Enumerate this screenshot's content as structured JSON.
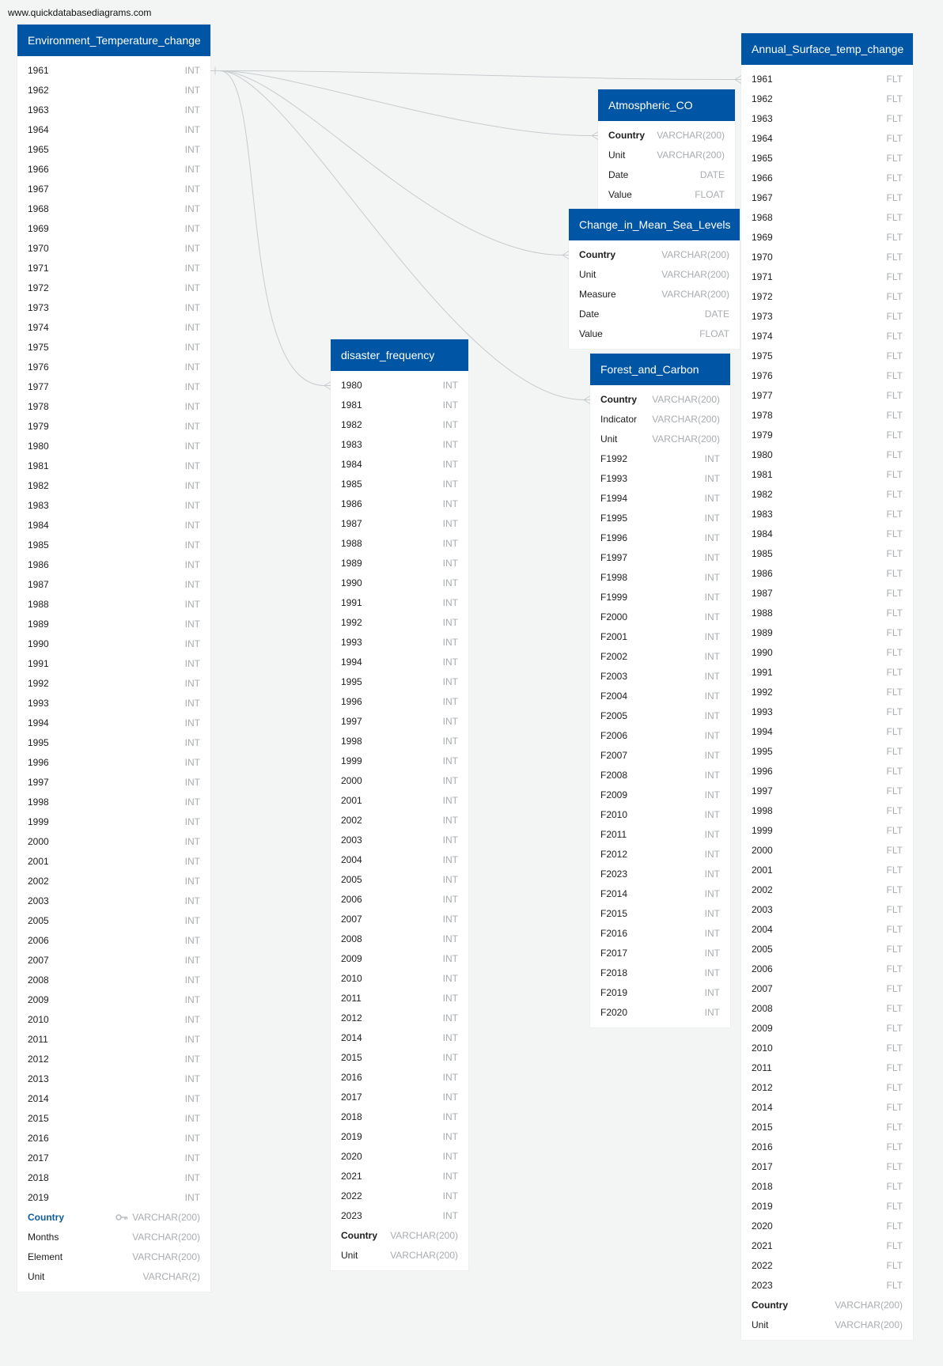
{
  "site_url": "www.quickdatabasediagrams.com",
  "tables": [
    {
      "id": "env",
      "title": "Environment_Temperature_change",
      "fields": [
        {
          "name": "1961",
          "type": "INT"
        },
        {
          "name": "1962",
          "type": "INT"
        },
        {
          "name": "1963",
          "type": "INT"
        },
        {
          "name": "1964",
          "type": "INT"
        },
        {
          "name": "1965",
          "type": "INT"
        },
        {
          "name": "1966",
          "type": "INT"
        },
        {
          "name": "1967",
          "type": "INT"
        },
        {
          "name": "1968",
          "type": "INT"
        },
        {
          "name": "1969",
          "type": "INT"
        },
        {
          "name": "1970",
          "type": "INT"
        },
        {
          "name": "1971",
          "type": "INT"
        },
        {
          "name": "1972",
          "type": "INT"
        },
        {
          "name": "1973",
          "type": "INT"
        },
        {
          "name": "1974",
          "type": "INT"
        },
        {
          "name": "1975",
          "type": "INT"
        },
        {
          "name": "1976",
          "type": "INT"
        },
        {
          "name": "1977",
          "type": "INT"
        },
        {
          "name": "1978",
          "type": "INT"
        },
        {
          "name": "1979",
          "type": "INT"
        },
        {
          "name": "1980",
          "type": "INT"
        },
        {
          "name": "1981",
          "type": "INT"
        },
        {
          "name": "1982",
          "type": "INT"
        },
        {
          "name": "1983",
          "type": "INT"
        },
        {
          "name": "1984",
          "type": "INT"
        },
        {
          "name": "1985",
          "type": "INT"
        },
        {
          "name": "1986",
          "type": "INT"
        },
        {
          "name": "1987",
          "type": "INT"
        },
        {
          "name": "1988",
          "type": "INT"
        },
        {
          "name": "1989",
          "type": "INT"
        },
        {
          "name": "1990",
          "type": "INT"
        },
        {
          "name": "1991",
          "type": "INT"
        },
        {
          "name": "1992",
          "type": "INT"
        },
        {
          "name": "1993",
          "type": "INT"
        },
        {
          "name": "1994",
          "type": "INT"
        },
        {
          "name": "1995",
          "type": "INT"
        },
        {
          "name": "1996",
          "type": "INT"
        },
        {
          "name": "1997",
          "type": "INT"
        },
        {
          "name": "1998",
          "type": "INT"
        },
        {
          "name": "1999",
          "type": "INT"
        },
        {
          "name": "2000",
          "type": "INT"
        },
        {
          "name": "2001",
          "type": "INT"
        },
        {
          "name": "2002",
          "type": "INT"
        },
        {
          "name": "2003",
          "type": "INT"
        },
        {
          "name": "2005",
          "type": "INT"
        },
        {
          "name": "2006",
          "type": "INT"
        },
        {
          "name": "2007",
          "type": "INT"
        },
        {
          "name": "2008",
          "type": "INT"
        },
        {
          "name": "2009",
          "type": "INT"
        },
        {
          "name": "2010",
          "type": "INT"
        },
        {
          "name": "2011",
          "type": "INT"
        },
        {
          "name": "2012",
          "type": "INT"
        },
        {
          "name": "2013",
          "type": "INT"
        },
        {
          "name": "2014",
          "type": "INT"
        },
        {
          "name": "2015",
          "type": "INT"
        },
        {
          "name": "2016",
          "type": "INT"
        },
        {
          "name": "2017",
          "type": "INT"
        },
        {
          "name": "2018",
          "type": "INT"
        },
        {
          "name": "2019",
          "type": "INT"
        },
        {
          "name": "Country",
          "type": "VARCHAR(200)",
          "pk": true,
          "key_icon": "key-icon",
          "style": "blue"
        },
        {
          "name": "Months",
          "type": "VARCHAR(200)"
        },
        {
          "name": "Element",
          "type": "VARCHAR(200)"
        },
        {
          "name": "Unit",
          "type": "VARCHAR(2)"
        }
      ]
    },
    {
      "id": "dis",
      "title": "disaster_frequency",
      "fields": [
        {
          "name": "1980",
          "type": "INT"
        },
        {
          "name": "1981",
          "type": "INT"
        },
        {
          "name": "1982",
          "type": "INT"
        },
        {
          "name": "1983",
          "type": "INT"
        },
        {
          "name": "1984",
          "type": "INT"
        },
        {
          "name": "1985",
          "type": "INT"
        },
        {
          "name": "1986",
          "type": "INT"
        },
        {
          "name": "1987",
          "type": "INT"
        },
        {
          "name": "1988",
          "type": "INT"
        },
        {
          "name": "1989",
          "type": "INT"
        },
        {
          "name": "1990",
          "type": "INT"
        },
        {
          "name": "1991",
          "type": "INT"
        },
        {
          "name": "1992",
          "type": "INT"
        },
        {
          "name": "1993",
          "type": "INT"
        },
        {
          "name": "1994",
          "type": "INT"
        },
        {
          "name": "1995",
          "type": "INT"
        },
        {
          "name": "1996",
          "type": "INT"
        },
        {
          "name": "1997",
          "type": "INT"
        },
        {
          "name": "1998",
          "type": "INT"
        },
        {
          "name": "1999",
          "type": "INT"
        },
        {
          "name": "2000",
          "type": "INT"
        },
        {
          "name": "2001",
          "type": "INT"
        },
        {
          "name": "2002",
          "type": "INT"
        },
        {
          "name": "2003",
          "type": "INT"
        },
        {
          "name": "2004",
          "type": "INT"
        },
        {
          "name": "2005",
          "type": "INT"
        },
        {
          "name": "2006",
          "type": "INT"
        },
        {
          "name": "2007",
          "type": "INT"
        },
        {
          "name": "2008",
          "type": "INT"
        },
        {
          "name": "2009",
          "type": "INT"
        },
        {
          "name": "2010",
          "type": "INT"
        },
        {
          "name": "2011",
          "type": "INT"
        },
        {
          "name": "2012",
          "type": "INT"
        },
        {
          "name": "2014",
          "type": "INT"
        },
        {
          "name": "2015",
          "type": "INT"
        },
        {
          "name": "2016",
          "type": "INT"
        },
        {
          "name": "2017",
          "type": "INT"
        },
        {
          "name": "2018",
          "type": "INT"
        },
        {
          "name": "2019",
          "type": "INT"
        },
        {
          "name": "2020",
          "type": "INT"
        },
        {
          "name": "2021",
          "type": "INT"
        },
        {
          "name": "2022",
          "type": "INT"
        },
        {
          "name": "2023",
          "type": "INT"
        },
        {
          "name": "Country",
          "type": "VARCHAR(200)",
          "pk": true
        },
        {
          "name": "Unit",
          "type": "VARCHAR(200)"
        }
      ]
    },
    {
      "id": "atm",
      "title": "Atmospheric_CO",
      "fields": [
        {
          "name": "Country",
          "type": "VARCHAR(200)",
          "pk": true
        },
        {
          "name": "Unit",
          "type": "VARCHAR(200)"
        },
        {
          "name": "Date",
          "type": "DATE"
        },
        {
          "name": "Value",
          "type": "FLOAT"
        }
      ]
    },
    {
      "id": "sea",
      "title": "Change_in_Mean_Sea_Levels",
      "fields": [
        {
          "name": "Country",
          "type": "VARCHAR(200)",
          "pk": true
        },
        {
          "name": "Unit",
          "type": "VARCHAR(200)"
        },
        {
          "name": "Measure",
          "type": "VARCHAR(200)"
        },
        {
          "name": "Date",
          "type": "DATE"
        },
        {
          "name": "Value",
          "type": "FLOAT"
        }
      ]
    },
    {
      "id": "forest",
      "title": "Forest_and_Carbon",
      "fields": [
        {
          "name": "Country",
          "type": "VARCHAR(200)",
          "pk": true
        },
        {
          "name": "Indicator",
          "type": "VARCHAR(200)"
        },
        {
          "name": "Unit",
          "type": "VARCHAR(200)"
        },
        {
          "name": "F1992",
          "type": "INT"
        },
        {
          "name": "F1993",
          "type": "INT"
        },
        {
          "name": "F1994",
          "type": "INT"
        },
        {
          "name": "F1995",
          "type": "INT"
        },
        {
          "name": "F1996",
          "type": "INT"
        },
        {
          "name": "F1997",
          "type": "INT"
        },
        {
          "name": "F1998",
          "type": "INT"
        },
        {
          "name": "F1999",
          "type": "INT"
        },
        {
          "name": "F2000",
          "type": "INT"
        },
        {
          "name": "F2001",
          "type": "INT"
        },
        {
          "name": "F2002",
          "type": "INT"
        },
        {
          "name": "F2003",
          "type": "INT"
        },
        {
          "name": "F2004",
          "type": "INT"
        },
        {
          "name": "F2005",
          "type": "INT"
        },
        {
          "name": "F2006",
          "type": "INT"
        },
        {
          "name": "F2007",
          "type": "INT"
        },
        {
          "name": "F2008",
          "type": "INT"
        },
        {
          "name": "F2009",
          "type": "INT"
        },
        {
          "name": "F2010",
          "type": "INT"
        },
        {
          "name": "F2011",
          "type": "INT"
        },
        {
          "name": "F2012",
          "type": "INT"
        },
        {
          "name": "F2023",
          "type": "INT"
        },
        {
          "name": "F2014",
          "type": "INT"
        },
        {
          "name": "F2015",
          "type": "INT"
        },
        {
          "name": "F2016",
          "type": "INT"
        },
        {
          "name": "F2017",
          "type": "INT"
        },
        {
          "name": "F2018",
          "type": "INT"
        },
        {
          "name": "F2019",
          "type": "INT"
        },
        {
          "name": "F2020",
          "type": "INT"
        }
      ]
    },
    {
      "id": "ann",
      "title": "Annual_Surface_temp_change",
      "fields": [
        {
          "name": "1961",
          "type": "FLT"
        },
        {
          "name": "1962",
          "type": "FLT"
        },
        {
          "name": "1963",
          "type": "FLT"
        },
        {
          "name": "1964",
          "type": "FLT"
        },
        {
          "name": "1965",
          "type": "FLT"
        },
        {
          "name": "1966",
          "type": "FLT"
        },
        {
          "name": "1967",
          "type": "FLT"
        },
        {
          "name": "1968",
          "type": "FLT"
        },
        {
          "name": "1969",
          "type": "FLT"
        },
        {
          "name": "1970",
          "type": "FLT"
        },
        {
          "name": "1971",
          "type": "FLT"
        },
        {
          "name": "1972",
          "type": "FLT"
        },
        {
          "name": "1973",
          "type": "FLT"
        },
        {
          "name": "1974",
          "type": "FLT"
        },
        {
          "name": "1975",
          "type": "FLT"
        },
        {
          "name": "1976",
          "type": "FLT"
        },
        {
          "name": "1977",
          "type": "FLT"
        },
        {
          "name": "1978",
          "type": "FLT"
        },
        {
          "name": "1979",
          "type": "FLT"
        },
        {
          "name": "1980",
          "type": "FLT"
        },
        {
          "name": "1981",
          "type": "FLT"
        },
        {
          "name": "1982",
          "type": "FLT"
        },
        {
          "name": "1983",
          "type": "FLT"
        },
        {
          "name": "1984",
          "type": "FLT"
        },
        {
          "name": "1985",
          "type": "FLT"
        },
        {
          "name": "1986",
          "type": "FLT"
        },
        {
          "name": "1987",
          "type": "FLT"
        },
        {
          "name": "1988",
          "type": "FLT"
        },
        {
          "name": "1989",
          "type": "FLT"
        },
        {
          "name": "1990",
          "type": "FLT"
        },
        {
          "name": "1991",
          "type": "FLT"
        },
        {
          "name": "1992",
          "type": "FLT"
        },
        {
          "name": "1993",
          "type": "FLT"
        },
        {
          "name": "1994",
          "type": "FLT"
        },
        {
          "name": "1995",
          "type": "FLT"
        },
        {
          "name": "1996",
          "type": "FLT"
        },
        {
          "name": "1997",
          "type": "FLT"
        },
        {
          "name": "1998",
          "type": "FLT"
        },
        {
          "name": "1999",
          "type": "FLT"
        },
        {
          "name": "2000",
          "type": "FLT"
        },
        {
          "name": "2001",
          "type": "FLT"
        },
        {
          "name": "2002",
          "type": "FLT"
        },
        {
          "name": "2003",
          "type": "FLT"
        },
        {
          "name": "2004",
          "type": "FLT"
        },
        {
          "name": "2005",
          "type": "FLT"
        },
        {
          "name": "2006",
          "type": "FLT"
        },
        {
          "name": "2007",
          "type": "FLT"
        },
        {
          "name": "2008",
          "type": "FLT"
        },
        {
          "name": "2009",
          "type": "FLT"
        },
        {
          "name": "2010",
          "type": "FLT"
        },
        {
          "name": "2011",
          "type": "FLT"
        },
        {
          "name": "2012",
          "type": "FLT"
        },
        {
          "name": "2014",
          "type": "FLT"
        },
        {
          "name": "2015",
          "type": "FLT"
        },
        {
          "name": "2016",
          "type": "FLT"
        },
        {
          "name": "2017",
          "type": "FLT"
        },
        {
          "name": "2018",
          "type": "FLT"
        },
        {
          "name": "2019",
          "type": "FLT"
        },
        {
          "name": "2020",
          "type": "FLT"
        },
        {
          "name": "2021",
          "type": "FLT"
        },
        {
          "name": "2022",
          "type": "FLT"
        },
        {
          "name": "2023",
          "type": "FLT"
        },
        {
          "name": "Country",
          "type": "VARCHAR(200)",
          "pk": true
        },
        {
          "name": "Unit",
          "type": "VARCHAR(200)"
        }
      ]
    }
  ],
  "relationships": [
    {
      "from": "env",
      "to": "ann"
    },
    {
      "from": "env",
      "to": "atm"
    },
    {
      "from": "env",
      "to": "sea"
    },
    {
      "from": "env",
      "to": "dis"
    },
    {
      "from": "env",
      "to": "forest"
    }
  ],
  "colors": {
    "header_bg": "#0056a4",
    "header_text": "#ffffff",
    "canvas_bg": "#f3f5f5",
    "type_text": "#a9adb0",
    "link_line": "#c7cbce",
    "pk_blue": "#0f5b9c"
  }
}
